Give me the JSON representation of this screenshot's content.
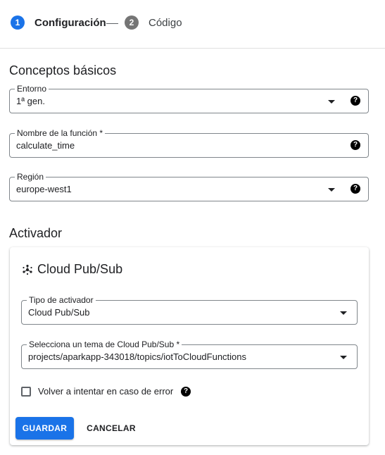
{
  "stepper": {
    "steps": [
      {
        "number": "1",
        "label": "Configuración",
        "active": true
      },
      {
        "number": "2",
        "label": "Código",
        "active": false
      }
    ]
  },
  "basics": {
    "title": "Conceptos básicos",
    "fields": [
      {
        "label": "Entorno",
        "value": "1ª gen.",
        "type": "select",
        "help_icon": "question-circle"
      },
      {
        "label": "Nombre de la función *",
        "value": "calculate_time",
        "type": "text",
        "help_icon": "question-circle"
      },
      {
        "label": "Región",
        "value": "europe-west1",
        "type": "select",
        "help_icon": "question-circle"
      }
    ]
  },
  "trigger": {
    "title": "Activador",
    "card": {
      "icon": "pubsub-icon",
      "title": "Cloud Pub/Sub",
      "fields": [
        {
          "label": "Tipo de activador",
          "value": "Cloud Pub/Sub",
          "type": "select"
        },
        {
          "label": "Selecciona un tema de Cloud Pub/Sub *",
          "value": "projects/aparkapp-343018/topics/iotToCloudFunctions",
          "type": "select"
        }
      ],
      "retry_checkbox": {
        "label": "Volver a intentar en caso de error",
        "checked": false,
        "help_icon": "question-circle"
      },
      "save_label": "GUARDAR",
      "cancel_label": "CANCELAR"
    }
  },
  "colors": {
    "primary": "#1a73e8",
    "step_inactive": "#757575",
    "border": "#80868b",
    "text": "#202124"
  }
}
